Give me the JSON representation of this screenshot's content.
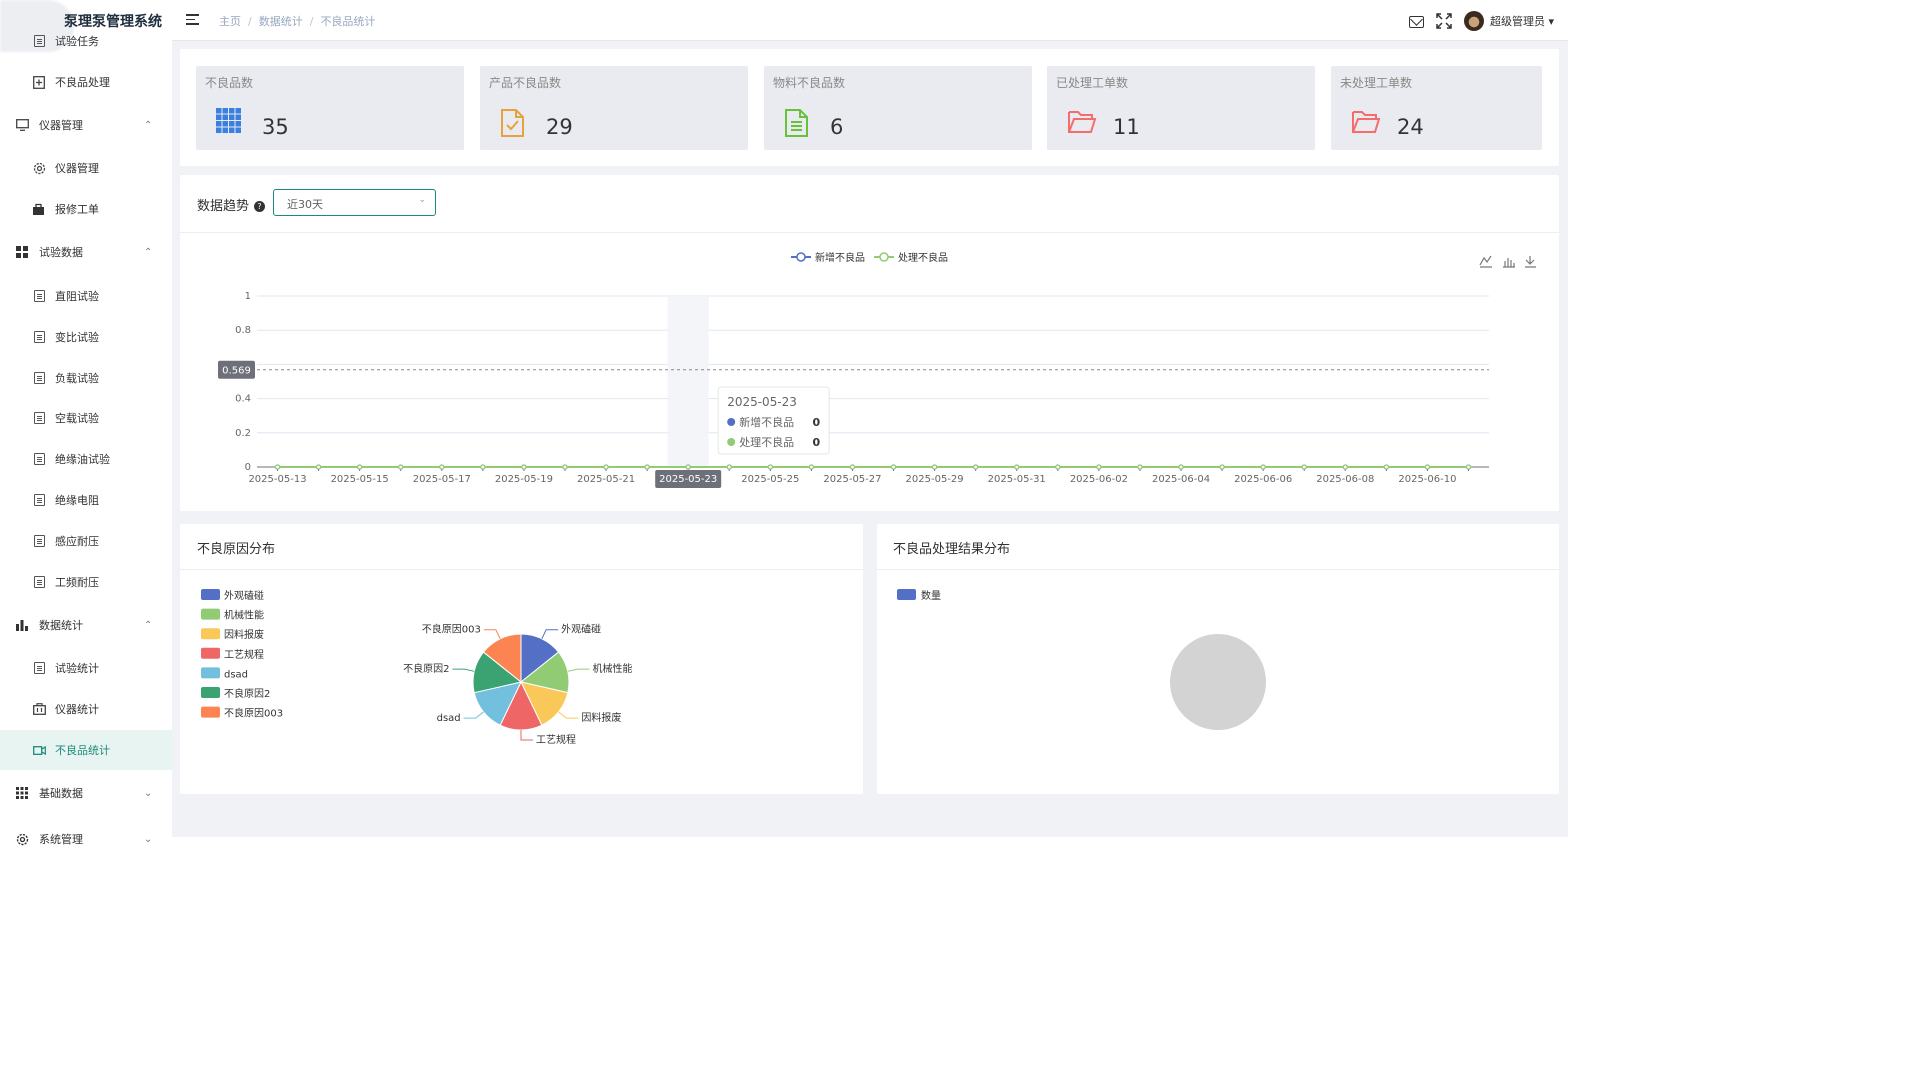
{
  "app": {
    "title": "泵理泵管理系统"
  },
  "sidebar": {
    "items": [
      {
        "label": "试验任务",
        "type": "sub",
        "icon": "task-icon"
      },
      {
        "label": "不良品处理",
        "type": "sub",
        "icon": "plus-doc-icon"
      },
      {
        "label": "仪器管理",
        "type": "group",
        "icon": "monitor-icon",
        "arrow": "⌃"
      },
      {
        "label": "仪器管理",
        "type": "sub",
        "icon": "gear-icon"
      },
      {
        "label": "报修工单",
        "type": "sub",
        "icon": "repair-icon"
      },
      {
        "label": "试验数据",
        "type": "group",
        "icon": "grid-icon",
        "arrow": "⌃"
      },
      {
        "label": "直阻试验",
        "type": "sub",
        "icon": "doc-icon"
      },
      {
        "label": "变比试验",
        "type": "sub",
        "icon": "doc-icon"
      },
      {
        "label": "负载试验",
        "type": "sub",
        "icon": "doc-icon"
      },
      {
        "label": "空载试验",
        "type": "sub",
        "icon": "doc-icon"
      },
      {
        "label": "绝缘油试验",
        "type": "sub",
        "icon": "doc-icon"
      },
      {
        "label": "绝缘电阻",
        "type": "sub",
        "icon": "doc-icon"
      },
      {
        "label": "感应耐压",
        "type": "sub",
        "icon": "doc-icon"
      },
      {
        "label": "工频耐压",
        "type": "sub",
        "icon": "doc-icon"
      },
      {
        "label": "数据统计",
        "type": "group",
        "icon": "bar-chart-icon",
        "arrow": "⌃"
      },
      {
        "label": "试验统计",
        "type": "sub",
        "icon": "stat-doc-icon"
      },
      {
        "label": "仪器统计",
        "type": "sub",
        "icon": "instrument-icon"
      },
      {
        "label": "不良品统计",
        "type": "sub",
        "icon": "video-icon",
        "active": true
      },
      {
        "label": "基础数据",
        "type": "group",
        "icon": "apps-icon",
        "arrow": "⌄"
      },
      {
        "label": "系统管理",
        "type": "group",
        "icon": "settings-icon",
        "arrow": "⌄"
      }
    ]
  },
  "header": {
    "breadcrumb": [
      "主页",
      "数据统计",
      "不良品统计"
    ],
    "separator": "/",
    "user": "超级管理员",
    "user_arrow": "▾",
    "icons": [
      "mail-icon",
      "fullscreen-icon",
      "avatar"
    ]
  },
  "stats": [
    {
      "label": "不良品数",
      "value": "35",
      "icon": "grid-apps-icon",
      "color": "#3b7fe0"
    },
    {
      "label": "产品不良品数",
      "value": "29",
      "icon": "doc-check-icon",
      "color": "#e6a23c"
    },
    {
      "label": "物料不良品数",
      "value": "6",
      "icon": "doc-lines-icon",
      "color": "#67c23a"
    },
    {
      "label": "已处理工单数",
      "value": "11",
      "icon": "folder-open-icon",
      "color": "#f56c6c"
    },
    {
      "label": "未处理工单数",
      "value": "24",
      "icon": "folder-open-icon",
      "color": "#f56c6c"
    }
  ],
  "trend": {
    "title": "数据趋势",
    "help": "?",
    "select_value": "近30天",
    "select_arrow": "⌄",
    "toolbox": [
      "line-chart-icon",
      "bar-chart-icon",
      "download-icon"
    ]
  },
  "pie1": {
    "title": "不良原因分布"
  },
  "pie2": {
    "title": "不良品处理结果分布"
  },
  "chart_data": [
    {
      "type": "line",
      "x": [
        "2025-05-13",
        "2025-05-14",
        "2025-05-15",
        "2025-05-16",
        "2025-05-17",
        "2025-05-18",
        "2025-05-19",
        "2025-05-20",
        "2025-05-21",
        "2025-05-22",
        "2025-05-23",
        "2025-05-24",
        "2025-05-25",
        "2025-05-26",
        "2025-05-27",
        "2025-05-28",
        "2025-05-29",
        "2025-05-30",
        "2025-05-31",
        "2025-06-01",
        "2025-06-02",
        "2025-06-03",
        "2025-06-04",
        "2025-06-05",
        "2025-06-06",
        "2025-06-07",
        "2025-06-08",
        "2025-06-09",
        "2025-06-10",
        "2025-06-11"
      ],
      "x_tick_labels": [
        "2025-05-13",
        "2025-05-15",
        "2025-05-17",
        "2025-05-19",
        "2025-05-21",
        "2025-05-23",
        "2025-05-25",
        "2025-05-27",
        "2025-05-29",
        "2025-05-31",
        "2025-06-02",
        "2025-06-04",
        "2025-06-06",
        "2025-06-08",
        "2025-06-10"
      ],
      "series": [
        {
          "name": "新增不良品",
          "color": "#5470c6",
          "values": [
            0,
            0,
            0,
            0,
            0,
            0,
            0,
            0,
            0,
            0,
            0,
            0,
            0,
            0,
            0,
            0,
            0,
            0,
            0,
            0,
            0,
            0,
            0,
            0,
            0,
            0,
            0,
            0,
            0,
            0
          ]
        },
        {
          "name": "处理不良品",
          "color": "#91cc75",
          "values": [
            0,
            0,
            0,
            0,
            0,
            0,
            0,
            0,
            0,
            0,
            0,
            0,
            0,
            0,
            0,
            0,
            0,
            0,
            0,
            0,
            0,
            0,
            0,
            0,
            0,
            0,
            0,
            0,
            0,
            0
          ]
        }
      ],
      "ylim": [
        0,
        1
      ],
      "y_tick_labels": [
        "0",
        "0.2",
        "0.4",
        "",
        "0.8",
        "1"
      ],
      "legend": "top-center",
      "grid": true,
      "tooltip": {
        "title": "2025-05-23",
        "rows": [
          {
            "name": "新增不良品",
            "value": "0"
          },
          {
            "name": "处理不良品",
            "value": "0"
          }
        ]
      },
      "axis_pointer": {
        "x_label": "2025-05-23",
        "y_label": "0.569",
        "y_value": 0.569
      }
    },
    {
      "type": "pie",
      "legend": "left",
      "categories": [
        "外观磕碰",
        "机械性能",
        "因料报废",
        "工艺规程",
        "dsad",
        "不良原因2",
        "不良原因003"
      ],
      "values": [
        1,
        1,
        1,
        1,
        1,
        1,
        1
      ],
      "colors": [
        "#5470c6",
        "#91cc75",
        "#fac858",
        "#ee6666",
        "#73c0de",
        "#3ba272",
        "#fc8452"
      ]
    },
    {
      "type": "pie",
      "legend": "top-left",
      "series": [
        {
          "name": "数量",
          "color": "#5470c6"
        }
      ],
      "values": [],
      "empty_color": "#d3d3d3"
    }
  ]
}
